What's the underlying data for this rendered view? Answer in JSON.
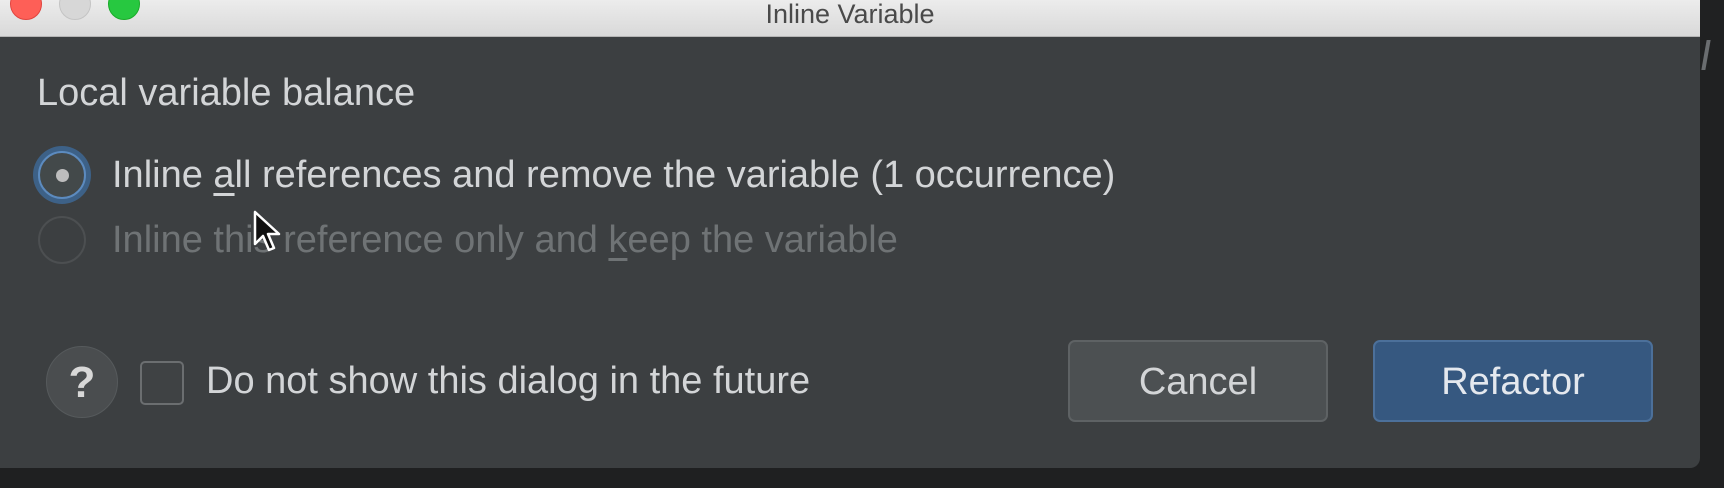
{
  "window": {
    "title": "Inline Variable"
  },
  "dialog": {
    "heading": "Local variable balance",
    "options": [
      {
        "label_pre": "Inline ",
        "label_mnemonic": "a",
        "label_post": "ll references and remove the variable (1 occurrence)",
        "selected": true,
        "enabled": true
      },
      {
        "label_pre": "Inline this reference only and ",
        "label_mnemonic": "k",
        "label_post": "eep the variable",
        "selected": false,
        "enabled": false
      }
    ],
    "help_label": "?",
    "dont_show_label": "Do not show this dialog in the future",
    "dont_show_checked": false,
    "cancel_label": "Cancel",
    "refactor_label": "Refactor"
  },
  "colors": {
    "background": "#3c3f41",
    "primary_button": "#365880",
    "focus_ring": "#3d6187",
    "text": "#d3d5d7",
    "disabled_text": "#6f7375"
  },
  "icons": {
    "close": "traffic-light-close",
    "minimize": "traffic-light-minimize",
    "zoom": "traffic-light-zoom",
    "pointer": "mouse-pointer-icon"
  }
}
